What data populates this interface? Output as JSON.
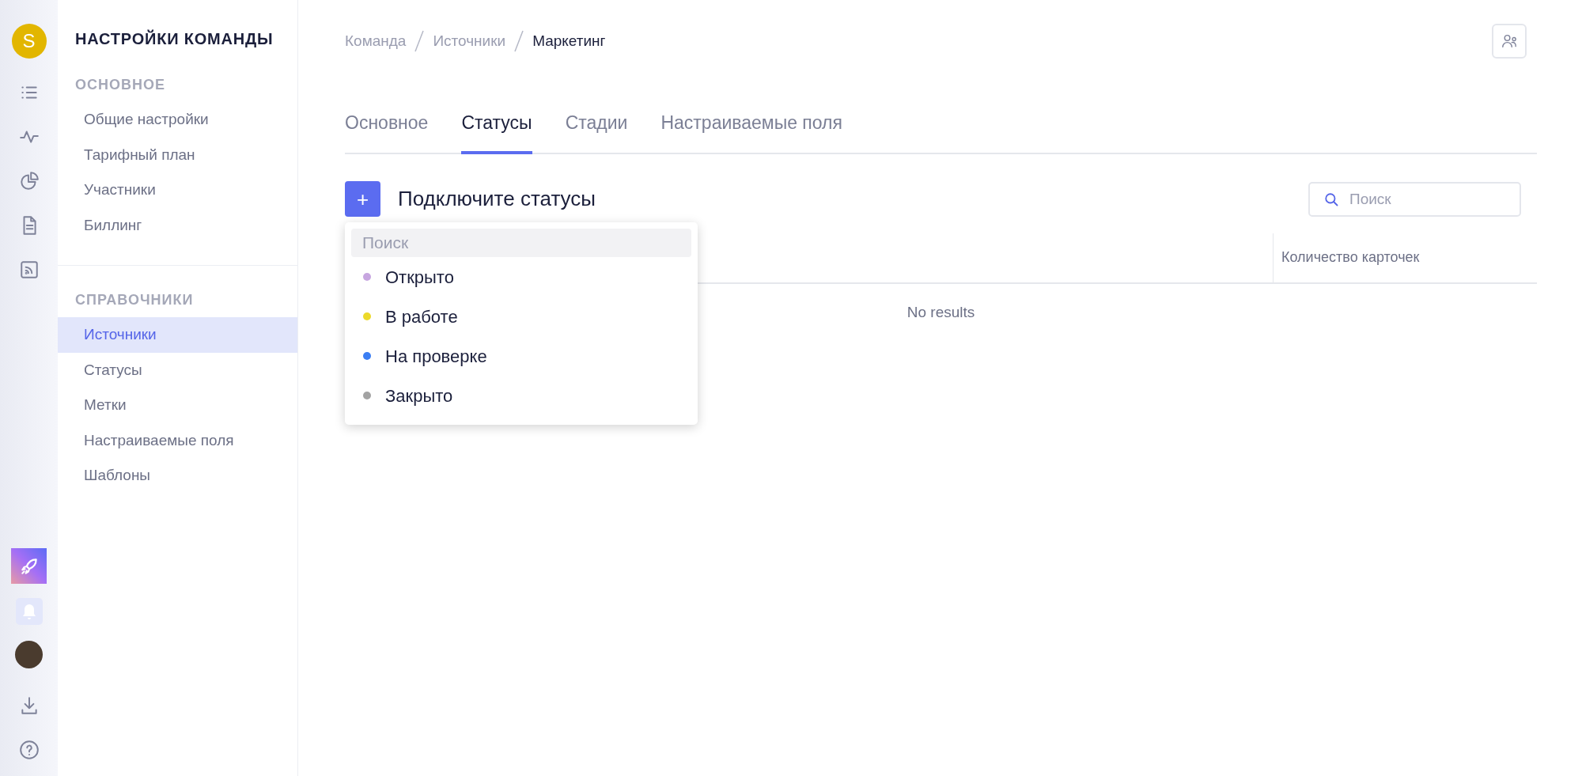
{
  "rail": {
    "avatar_letter": "S"
  },
  "sidebar": {
    "title": "НАСТРОЙКИ КОМАНДЫ",
    "sections": [
      {
        "heading": "ОСНОВНОЕ",
        "items": [
          {
            "label": "Общие настройки",
            "selected": false
          },
          {
            "label": "Тарифный план",
            "selected": false
          },
          {
            "label": "Участники",
            "selected": false
          },
          {
            "label": "Биллинг",
            "selected": false
          }
        ]
      },
      {
        "heading": "СПРАВОЧНИКИ",
        "items": [
          {
            "label": "Источники",
            "selected": true
          },
          {
            "label": "Статусы",
            "selected": false
          },
          {
            "label": "Метки",
            "selected": false
          },
          {
            "label": "Настраиваемые поля",
            "selected": false
          },
          {
            "label": "Шаблоны",
            "selected": false
          }
        ]
      }
    ]
  },
  "breadcrumbs": [
    "Команда",
    "Источники",
    "Маркетинг"
  ],
  "tabs": [
    {
      "label": "Основное",
      "selected": false
    },
    {
      "label": "Статусы",
      "selected": true
    },
    {
      "label": "Стадии",
      "selected": false
    },
    {
      "label": "Настраиваемые поля",
      "selected": false
    }
  ],
  "toolbar": {
    "add_button": "+",
    "heading": "Подключите статусы",
    "search": {
      "placeholder": "Поиск"
    }
  },
  "table": {
    "columns": [
      "Количество карточек"
    ],
    "empty_text": "No results"
  },
  "dropdown": {
    "search": {
      "placeholder": "Поиск"
    },
    "items": [
      {
        "label": "Открыто",
        "color": "#c7a6e0"
      },
      {
        "label": "В работе",
        "color": "#ecd92a"
      },
      {
        "label": "На проверке",
        "color": "#3b7ef3"
      },
      {
        "label": "Закрыто",
        "color": "#a3a3a3"
      }
    ]
  }
}
